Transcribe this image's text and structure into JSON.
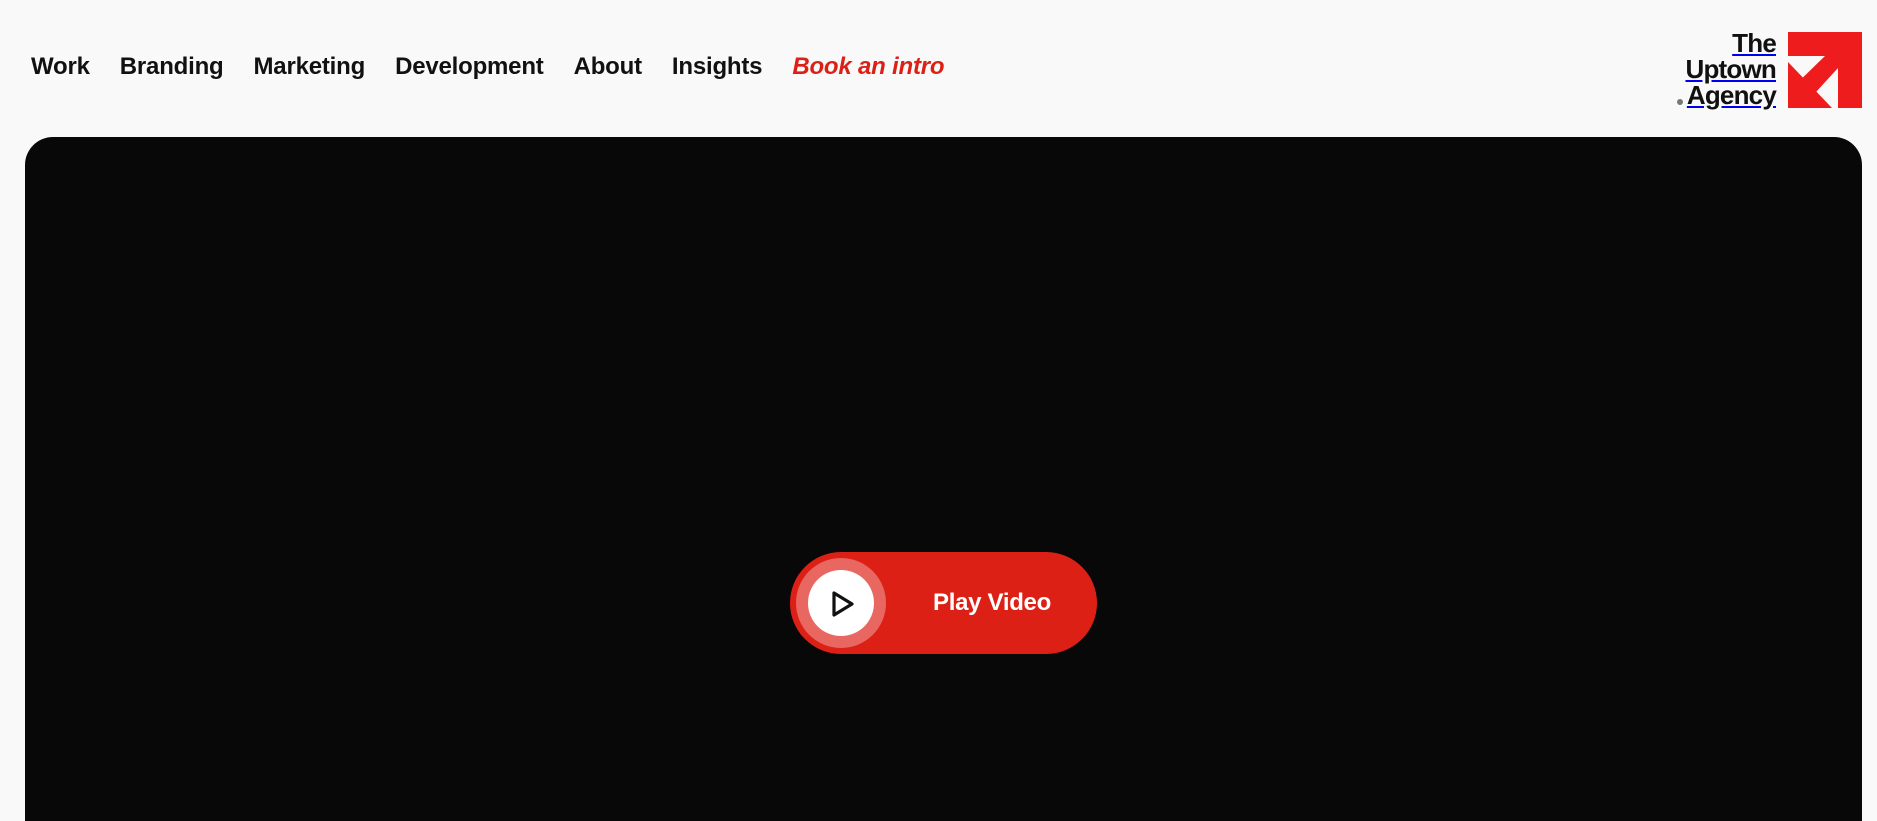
{
  "nav": {
    "items": [
      {
        "label": "Work"
      },
      {
        "label": "Branding"
      },
      {
        "label": "Marketing"
      },
      {
        "label": "Development"
      },
      {
        "label": "About"
      },
      {
        "label": "Insights"
      }
    ],
    "cta_label": "Book an intro"
  },
  "logo": {
    "line1": "The",
    "line2": "Uptown",
    "line3": "Agency",
    "mark_icon": "arrow-up-right-icon"
  },
  "hero": {
    "play_label": "Play Video",
    "play_icon": "play-icon"
  },
  "colors": {
    "accent": "#dd2016",
    "hero_background": "#080808",
    "page_background": "#f9f9f9",
    "text": "#111111"
  }
}
